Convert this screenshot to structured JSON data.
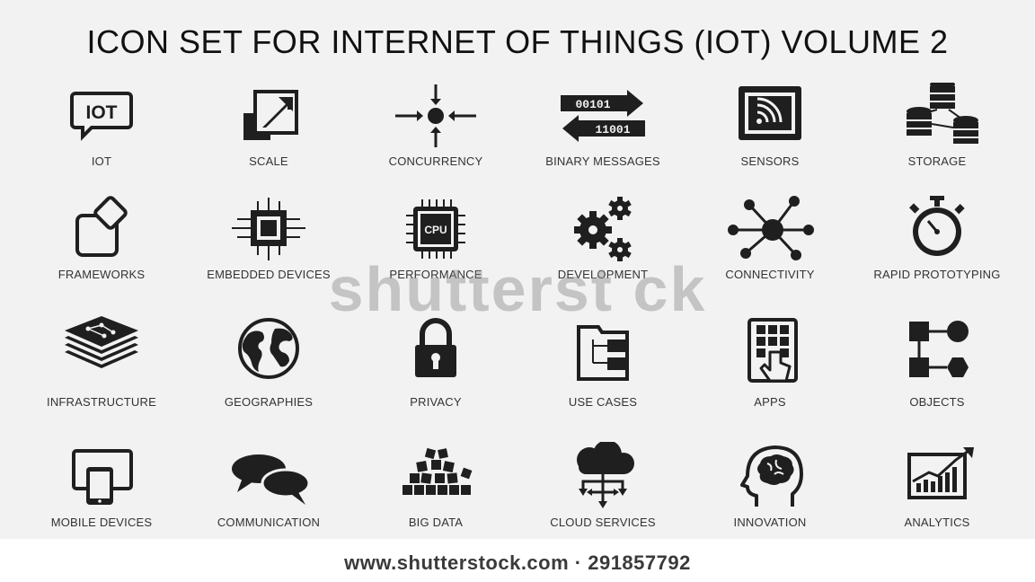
{
  "title": "ICON SET FOR INTERNET OF THINGS (IOT) VOLUME 2",
  "icons": [
    {
      "label": "IOT",
      "icon": "iot-speech-bubble-icon",
      "icon_text": "IOT"
    },
    {
      "label": "SCALE",
      "icon": "scale-icon"
    },
    {
      "label": "CONCURRENCY",
      "icon": "concurrency-icon"
    },
    {
      "label": "BINARY MESSAGES",
      "icon": "binary-messages-icon",
      "icon_text_1": "00101",
      "icon_text_2": "11001"
    },
    {
      "label": "SENSORS",
      "icon": "sensor-icon"
    },
    {
      "label": "STORAGE",
      "icon": "storage-icon"
    },
    {
      "label": "FRAMEWORKS",
      "icon": "frameworks-icon"
    },
    {
      "label": "EMBEDDED DEVICES",
      "icon": "chip-icon"
    },
    {
      "label": "PERFORMANCE",
      "icon": "cpu-icon",
      "icon_text": "CPU"
    },
    {
      "label": "DEVELOPMENT",
      "icon": "gears-icon"
    },
    {
      "label": "CONNECTIVITY",
      "icon": "network-hub-icon"
    },
    {
      "label": "RAPID PROTOTYPING",
      "icon": "stopwatch-icon"
    },
    {
      "label": "INFRASTRUCTURE",
      "icon": "layers-icon"
    },
    {
      "label": "GEOGRAPHIES",
      "icon": "globe-icon"
    },
    {
      "label": "PRIVACY",
      "icon": "padlock-icon"
    },
    {
      "label": "USE CASES",
      "icon": "use-cases-icon"
    },
    {
      "label": "APPS",
      "icon": "apps-touch-icon"
    },
    {
      "label": "OBJECTS",
      "icon": "objects-icon"
    },
    {
      "label": "MOBILE DEVICES",
      "icon": "mobile-devices-icon"
    },
    {
      "label": "COMMUNICATION",
      "icon": "chat-bubbles-icon"
    },
    {
      "label": "BIG DATA",
      "icon": "big-data-icon"
    },
    {
      "label": "CLOUD SERVICES",
      "icon": "cloud-tree-icon"
    },
    {
      "label": "INNOVATION",
      "icon": "head-brain-icon"
    },
    {
      "label": "ANALYTICS",
      "icon": "analytics-chart-icon"
    }
  ],
  "watermark": "shutterst ck",
  "footer": "www.shutterstock.com · 291857792",
  "colors": {
    "icon": "#1f1f1f",
    "background": "#f2f2f2",
    "footer_bg": "#ffffff"
  }
}
